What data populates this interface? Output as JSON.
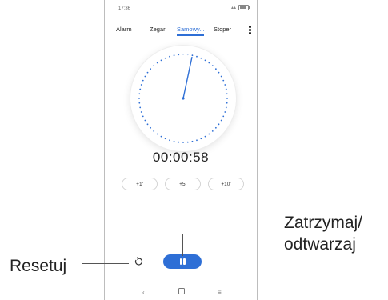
{
  "status_bar": {
    "time": "17:36"
  },
  "tabs": [
    {
      "label": "Alarm",
      "active": false
    },
    {
      "label": "Zegar",
      "active": false
    },
    {
      "label": "Samowy...",
      "active": true
    },
    {
      "label": "Stoper",
      "active": false
    }
  ],
  "timer": {
    "display": "00:00:58",
    "remaining_seconds": 58
  },
  "add_time_buttons": [
    {
      "label": "+1'"
    },
    {
      "label": "+5'"
    },
    {
      "label": "+10'"
    }
  ],
  "controls": {
    "reset_icon": "reset-icon",
    "pause_icon": "pause-icon",
    "accent_color": "#2e6fd6"
  },
  "nav_bar": {
    "back_icon": "back-chevron-icon",
    "home_icon": "home-icon",
    "recents_icon": "recents-icon"
  },
  "annotations": {
    "reset_label": "Resetuj",
    "pause_label_line1": "Zatrzymaj/",
    "pause_label_line2": "odtwarzaj"
  }
}
